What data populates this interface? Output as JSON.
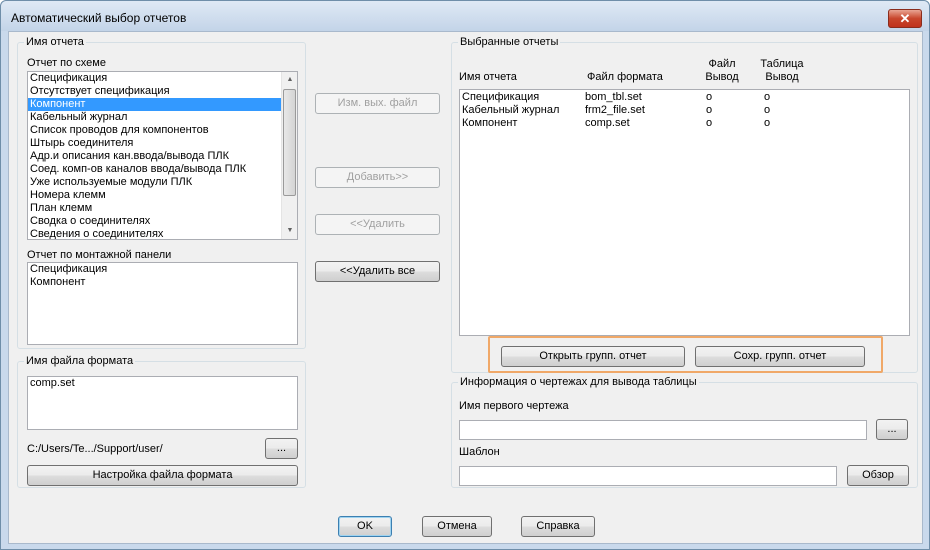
{
  "window": {
    "title": "Автоматический выбор отчетов",
    "close_glyph": "✕"
  },
  "report_name": {
    "group_label": "Имя отчета",
    "schema_label": "Отчет по схеме",
    "schema_items": [
      "Спецификация",
      "Отсутствует спецификация",
      "Компонент",
      "Кабельный журнал",
      "Список проводов для компонентов",
      "Штырь соединителя",
      "Адр.и описания кан.ввода/вывода ПЛК",
      "Соед. комп-ов каналов ввода/вывода ПЛК",
      "Уже используемые модули ПЛК",
      "Номера клемм",
      "План клемм",
      "Сводка о соединителях",
      "Сведения о соединителях"
    ],
    "schema_selected_index": 2,
    "panel_label": "Отчет по монтажной панели",
    "panel_items": [
      "Спецификация",
      "Компонент"
    ]
  },
  "format_file": {
    "group_label": "Имя файла формата",
    "items": [
      "comp.set"
    ],
    "path": "C:/Users/Te.../Support/user/",
    "browse_label": "...",
    "setup_label": "Настройка файла формата"
  },
  "middle": {
    "change_output_label": "Изм. вых. файл",
    "add_label": "Добавить>>",
    "remove_label": "<<Удалить",
    "remove_all_label": "<<Удалить все"
  },
  "selected": {
    "group_label": "Выбранные отчеты",
    "col_name": "Имя отчета",
    "col_format": "Файл формата",
    "col_file_top": "Файл",
    "col_file_bottom": "Вывод",
    "col_table_top": "Таблица",
    "col_table_bottom": "Вывод",
    "rows": [
      {
        "name": "Спецификация",
        "format": "bom_tbl.set",
        "file": "o",
        "table": "o"
      },
      {
        "name": "Кабельный журнал",
        "format": "frm2_file.set",
        "file": "o",
        "table": "o"
      },
      {
        "name": "Компонент",
        "format": "comp.set",
        "file": "o",
        "table": "o"
      }
    ],
    "open_group_label": "Открыть групп. отчет",
    "save_group_label": "Сохр. групп. отчет"
  },
  "drawing_info": {
    "group_label": "Информация о чертежах для вывода таблицы",
    "first_drawing_label": "Имя первого чертежа",
    "first_drawing_value": "",
    "browse_label": "...",
    "template_label": "Шаблон",
    "template_value": "",
    "review_label": "Обзор"
  },
  "footer": {
    "ok_label": "OK",
    "cancel_label": "Отмена",
    "help_label": "Справка"
  }
}
